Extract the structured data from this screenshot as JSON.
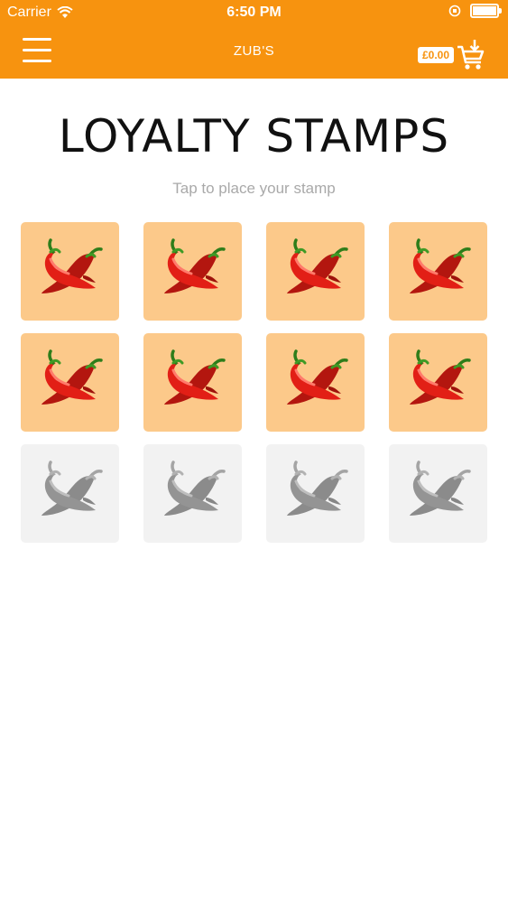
{
  "status_bar": {
    "carrier": "Carrier",
    "time": "6:50 PM"
  },
  "nav": {
    "brand": "ZUB'S",
    "cart_total": "£0.00"
  },
  "page": {
    "title": "LOYALTY STAMPS",
    "subtitle": "Tap to place your stamp"
  },
  "stamps": [
    {
      "state": "stamped"
    },
    {
      "state": "stamped"
    },
    {
      "state": "stamped"
    },
    {
      "state": "stamped"
    },
    {
      "state": "stamped"
    },
    {
      "state": "stamped"
    },
    {
      "state": "stamped"
    },
    {
      "state": "stamped"
    },
    {
      "state": "empty"
    },
    {
      "state": "empty"
    },
    {
      "state": "empty"
    },
    {
      "state": "empty"
    }
  ],
  "colors": {
    "header": "#f7930f",
    "stamp_filled": "#fcc98a",
    "stamp_empty": "#f2f2f2"
  },
  "icons": {
    "menu": "hamburger-icon",
    "cart": "cart-download-icon",
    "stamp": "chili-pepper-icon"
  }
}
